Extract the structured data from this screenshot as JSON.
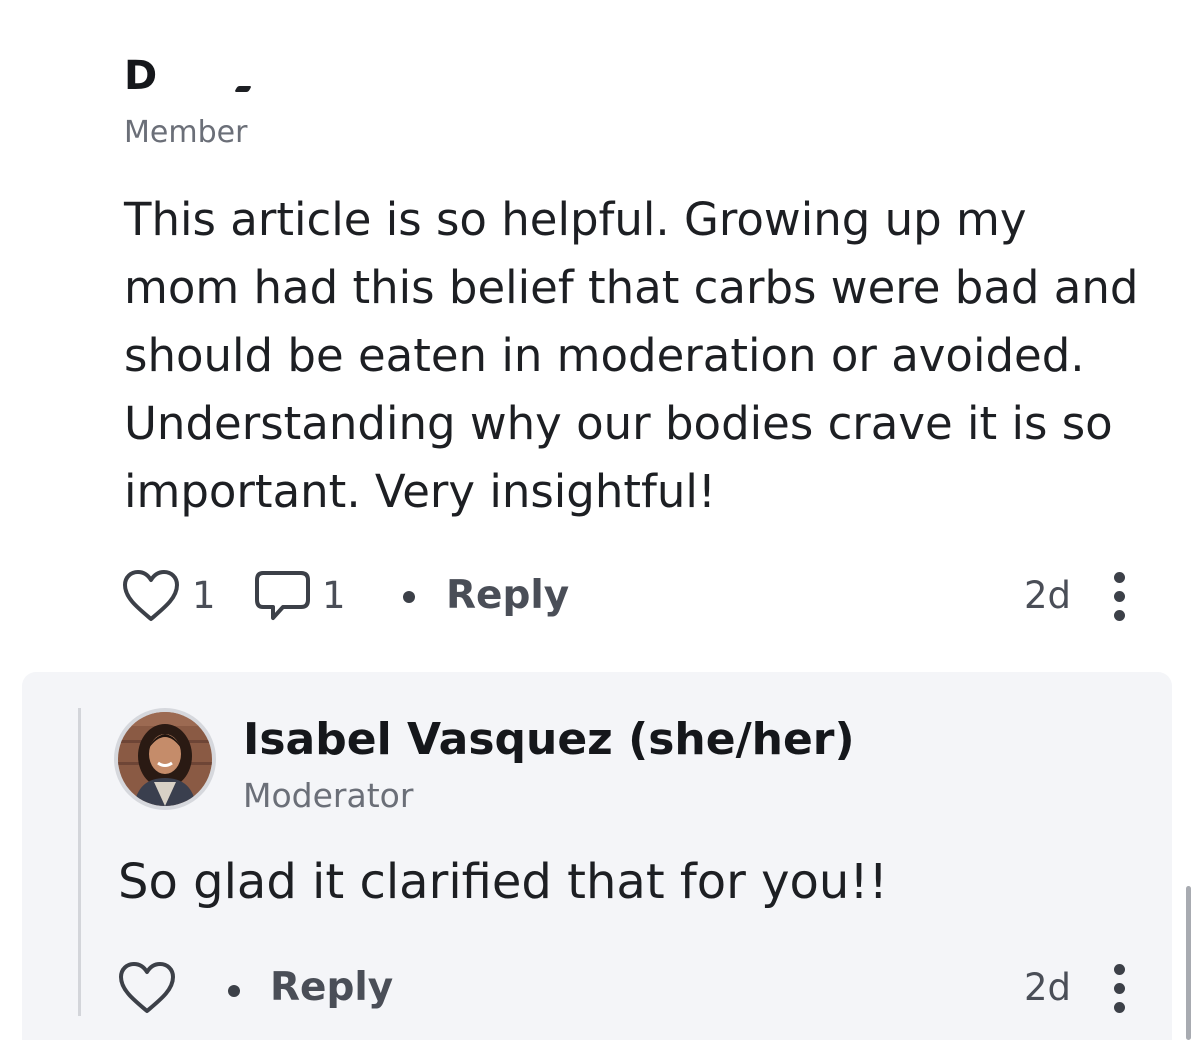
{
  "comment": {
    "author_initial": "D",
    "author_role": "Member",
    "body": "This article is so helpful. Growing up my mom had this belief that carbs were bad and should be eaten in moderation or avoided. Understanding why our bodies crave it is so important. Very insightful!",
    "likes": "1",
    "replies": "1",
    "reply_label": "Reply",
    "time": "2d",
    "icons": {
      "like": "heart-icon",
      "comments": "speech-bubble-icon",
      "more": "more-vertical-icon"
    }
  },
  "reply": {
    "author": "Isabel Vasquez (she/her)",
    "author_role": "Moderator",
    "body": "So glad it clarified that for you!!",
    "reply_label": "Reply",
    "time": "2d",
    "icons": {
      "like": "heart-icon",
      "more": "more-vertical-icon",
      "avatar": "avatar"
    }
  },
  "colors": {
    "text": "#1d1f23",
    "muted": "#6b6f78",
    "action": "#4a4e57",
    "reply_background": "#f4f5f8"
  }
}
